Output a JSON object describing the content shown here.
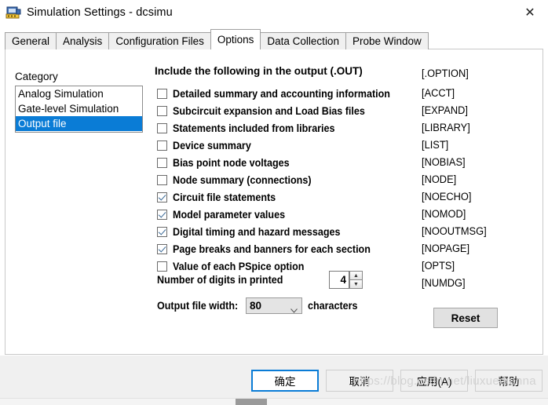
{
  "window": {
    "title": "Simulation Settings - dcsimu",
    "icon": "simulation-settings-icon",
    "close_icon": "✕"
  },
  "tabs": [
    {
      "label": "General",
      "active": false
    },
    {
      "label": "Analysis",
      "active": false
    },
    {
      "label": "Configuration Files",
      "active": false
    },
    {
      "label": "Options",
      "active": true
    },
    {
      "label": "Data Collection",
      "active": false
    },
    {
      "label": "Probe Window",
      "active": false
    }
  ],
  "category": {
    "label": "Category",
    "items": [
      {
        "label": "Analog Simulation",
        "selected": false
      },
      {
        "label": "Gate-level Simulation",
        "selected": false
      },
      {
        "label": "Output file",
        "selected": true
      }
    ]
  },
  "options": {
    "heading": "Include the following in the output (.OUT)",
    "heading_option": "[.OPTION]",
    "rows": [
      {
        "label": "Detailed summary and accounting information",
        "checked": false,
        "option": "[ACCT]"
      },
      {
        "label": "Subcircuit expansion and Load Bias files",
        "checked": false,
        "option": "[EXPAND]"
      },
      {
        "label": "Statements included from libraries",
        "checked": false,
        "option": "[LIBRARY]"
      },
      {
        "label": "Device summary",
        "checked": false,
        "option": "[LIST]"
      },
      {
        "label": "Bias point node voltages",
        "checked": false,
        "option": "[NOBIAS]"
      },
      {
        "label": "Node summary (connections)",
        "checked": false,
        "option": "[NODE]"
      },
      {
        "label": "Circuit file statements",
        "checked": true,
        "option": "[NOECHO]"
      },
      {
        "label": "Model parameter values",
        "checked": true,
        "option": "[NOMOD]"
      },
      {
        "label": "Digital timing and hazard messages",
        "checked": true,
        "option": "[NOOUTMSG]"
      },
      {
        "label": "Page breaks and banners for each section",
        "checked": true,
        "option": "[NOPAGE]"
      },
      {
        "label": "Value of each PSpice option",
        "checked": false,
        "option": "[OPTS]"
      }
    ],
    "digits": {
      "label": "Number of digits in printed",
      "value": "4",
      "option": "[NUMDG]",
      "up_glyph": "▲",
      "down_glyph": "▼"
    },
    "width": {
      "label": "Output file width:",
      "value": "80",
      "suffix": "characters",
      "arrow_glyph": "⌵"
    },
    "reset_label": "Reset"
  },
  "footer": {
    "buttons": [
      {
        "id": "ok",
        "label": "确定",
        "primary": true
      },
      {
        "id": "cancel",
        "label": "取消",
        "primary": false
      },
      {
        "id": "apply",
        "label": "应用(A)",
        "primary": false
      },
      {
        "id": "help",
        "label": "帮助",
        "primary": false
      }
    ],
    "watermark": "https://blog.csdn.net/liuxuedianna"
  },
  "colors": {
    "selection_blue": "#0a7cd6",
    "dialog_face": "#f0f0f0",
    "check_mark": "#3b6a97"
  }
}
